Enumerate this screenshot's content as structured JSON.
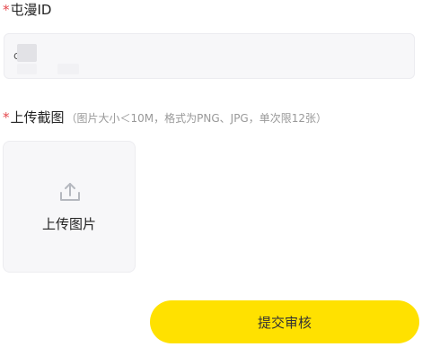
{
  "form": {
    "required_mark": "*",
    "id_field": {
      "label": "屯漫ID",
      "value": "c"
    },
    "screenshot_field": {
      "label": "上传截图",
      "hint": "（图片大小＜10M，格式为PNG、JPG，单次限12张）",
      "upload_button_label": "上传图片",
      "upload_icon": "upload-icon"
    },
    "submit_label": "提交审核",
    "colors": {
      "required": "#e5484d",
      "submit_bg": "#ffe100",
      "field_bg": "#f7f7f9"
    }
  }
}
